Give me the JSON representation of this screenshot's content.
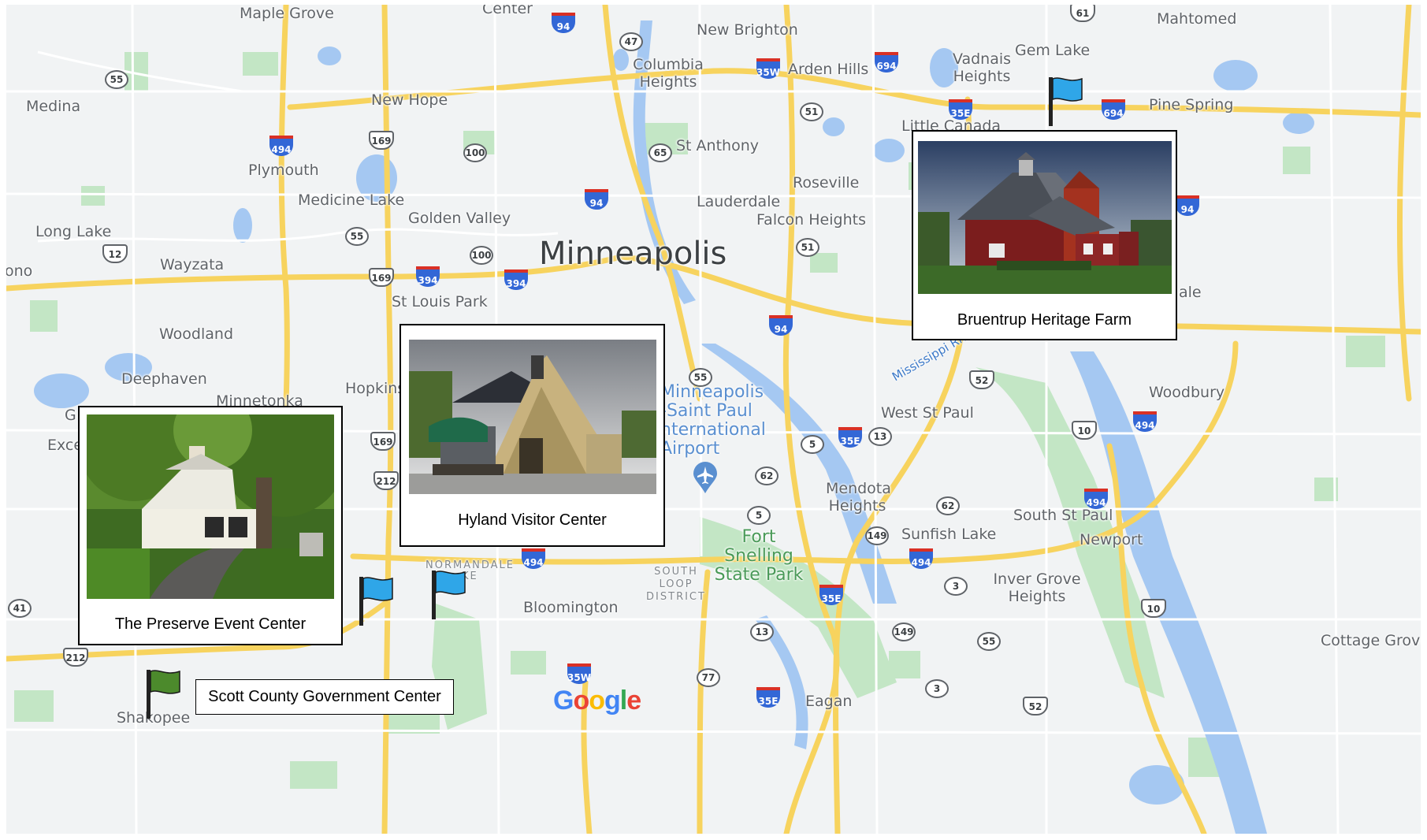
{
  "map": {
    "places": {
      "maple_grove": "Maple Grove",
      "center": "Center",
      "new_brighton": "New Brighton",
      "mahtomedi": "Mahtomed",
      "columbia_heights": "Columbia Heights",
      "arden_hills": "Arden Hills",
      "vadnais_heights": "Vadnais Heights",
      "gem_lake": "Gem Lake",
      "pine_springs": "Pine Spring",
      "little_canada": "Little Canada",
      "medina": "Medina",
      "new_hope": "New Hope",
      "st_anthony": "St Anthony",
      "plymouth": "Plymouth",
      "roseville": "Roseville",
      "lauderdale": "Lauderdale",
      "medicine_lake": "Medicine Lake",
      "golden_valley": "Golden Valley",
      "falcon_heights": "Falcon Heights",
      "long_lake": "Long Lake",
      "minneapolis": "Minneapolis",
      "wayzata": "Wayzata",
      "orono": "ono",
      "st_louis_park": "St Louis Park",
      "oakdale": "ale",
      "woodland": "Woodland",
      "deephaven": "Deephaven",
      "minnetonka": "Minnetonka",
      "hopkins": "Hopkins",
      "airport": "Minneapolis -Saint Paul nternational Airport",
      "mississippi": "Mississippi Riv",
      "woodbury": "Woodbury",
      "west_st_paul": "West St Paul",
      "greenwood": "G",
      "excelsior": "Exce",
      "mendota_heights": "Mendota Heights",
      "south_st_paul": "South St Paul",
      "fort_snelling": "Fort Snelling State Park",
      "sunfish_lake": "Sunfish Lake",
      "newport": "Newport",
      "normandale": "NORMANDALE",
      "normandale_lake": "KE",
      "south_loop": "SOUTH LOOP DISTRICT",
      "inver_grove": "Inver Grove Heights",
      "bloomington": "Bloomington",
      "cottage_grove": "Cottage Grove",
      "eagan": "Eagan",
      "shakopee": "Shakopee"
    },
    "shields": {
      "i94_top": "94",
      "us61": "61",
      "st47": "47",
      "i35w_top": "35W",
      "i694_a": "694",
      "st55_w": "55",
      "i35e_top": "35E",
      "i694_b": "694",
      "st51_top": "51",
      "i494_nw": "494",
      "us169_top": "169",
      "st100_top": "100",
      "st65": "65",
      "i94_mid": "94",
      "i94_e": "94",
      "st55_mid": "55",
      "st51_mid": "51",
      "us12": "12",
      "us169_mid": "169",
      "i394_a": "394",
      "st100_mid": "100",
      "i394_b": "394",
      "i94_low": "94",
      "st55_air": "55",
      "us52_top": "52",
      "us169_low": "169",
      "us212_a": "212",
      "i35e_wsp": "35E",
      "st13_wsp": "13",
      "st5_a": "5",
      "us10_a": "10",
      "i494_e": "494",
      "st62_a": "62",
      "st62_b": "62",
      "i494_ssp": "494",
      "st5_b": "5",
      "st149_a": "149",
      "i494_s": "494",
      "i494_nrm": "494",
      "st3_a": "3",
      "st41": "41",
      "i35e_low": "35E",
      "us10_b": "10",
      "us212_b": "212",
      "st13_low": "13",
      "st149_b": "149",
      "st55_low": "55",
      "i35w_low": "35W",
      "st77": "77",
      "st3_b": "3",
      "i35e_bot": "35E",
      "us52_bot": "52"
    },
    "logo": "Google"
  },
  "cards": {
    "bruentrup": {
      "caption": "Bruentrup Heritage Farm"
    },
    "hyland": {
      "caption": "Hyland Visitor Center"
    },
    "preserve": {
      "caption": "The Preserve Event Center"
    },
    "scott": {
      "caption": "Scott County Government Center"
    }
  },
  "colors": {
    "flag_blue": "#2fa6e8",
    "flag_green": "#4c8a2c",
    "water": "#9ec3f0",
    "park": "#b9e3bd",
    "highway": "#f7d35e",
    "land": "#f1f3f4"
  }
}
